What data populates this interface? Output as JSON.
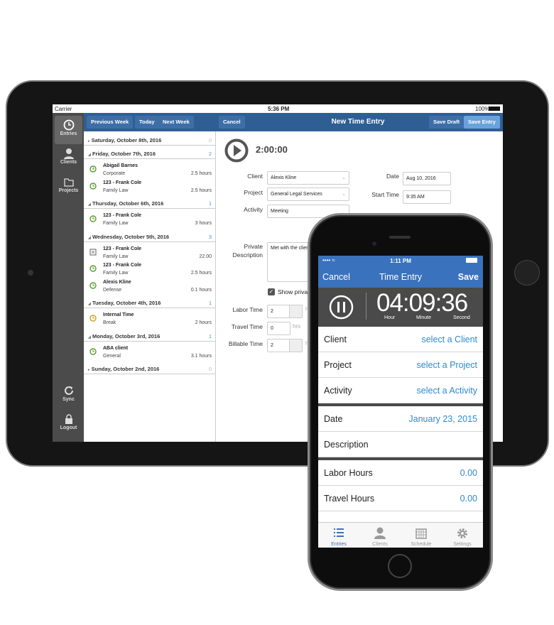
{
  "tablet": {
    "status": {
      "carrier": "Carrier",
      "time": "5:36 PM",
      "battery": "100%"
    },
    "sidebar": {
      "items": [
        {
          "label": "Entries",
          "icon": "clock-icon"
        },
        {
          "label": "Clients",
          "icon": "person-icon"
        },
        {
          "label": "Projects",
          "icon": "folder-icon"
        }
      ],
      "bottom": [
        {
          "label": "Sync",
          "icon": "sync-icon"
        },
        {
          "label": "Logout",
          "icon": "lock-icon"
        }
      ]
    },
    "nav": {
      "prev": "Previous Week",
      "today": "Today",
      "next": "Next Week"
    },
    "header": {
      "cancel": "Cancel",
      "title": "New Time Entry",
      "save_draft": "Save Draft",
      "save_entry": "Save Entry"
    },
    "days": [
      {
        "label": "Saturday, October 8th, 2016",
        "count": "0",
        "entries": []
      },
      {
        "label": "Friday, October 7th, 2016",
        "count": "2",
        "entries": [
          {
            "name": "Abigail Barnes",
            "sub": "Corporate",
            "hours": "2.5 hours",
            "icon": "clock"
          },
          {
            "name": "123 - Frank Cole",
            "sub": "Family Law",
            "hours": "2.5 hours",
            "icon": "clock"
          }
        ]
      },
      {
        "label": "Thursday, October 6th, 2016",
        "count": "1",
        "entries": [
          {
            "name": "123 - Frank Cole",
            "sub": "Family Law",
            "hours": "3 hours",
            "icon": "clock"
          }
        ]
      },
      {
        "label": "Wednesday, October 5th, 2016",
        "count": "3",
        "entries": [
          {
            "name": "123 - Frank Cole",
            "sub": "Family Law",
            "hours": "22.00",
            "icon": "expense"
          },
          {
            "name": "123 - Frank Cole",
            "sub": "Family Law",
            "hours": "2.5 hours",
            "icon": "clock"
          },
          {
            "name": "Alexis Kline",
            "sub": "Defense",
            "hours": "0.1 hours",
            "icon": "clock"
          }
        ]
      },
      {
        "label": "Tuesday, October 4th, 2016",
        "count": "1",
        "entries": [
          {
            "name": "Internal Time",
            "sub": "Break",
            "hours": "2 hours",
            "icon": "clock-yellow"
          }
        ]
      },
      {
        "label": "Monday, October 3rd, 2016",
        "count": "1",
        "entries": [
          {
            "name": "ABA client",
            "sub": "General",
            "hours": "3.1 hours",
            "icon": "clock"
          }
        ]
      },
      {
        "label": "Sunday, October 2nd, 2016",
        "count": "0",
        "entries": []
      }
    ],
    "form": {
      "timer": "2:00:00",
      "client_label": "Client",
      "client": "Alexis Kline",
      "project_label": "Project",
      "project": "General Legal Services",
      "activity_label": "Activity",
      "activity": "Meeting",
      "date_label": "Date",
      "date": "Aug 10, 2016",
      "start_label": "Start Time",
      "start": "9:35 AM",
      "desc_label_1": "Private",
      "desc_label_2": "Description",
      "desc": "Met with the client",
      "show_private": "Show priva",
      "labor_label": "Labor Time",
      "labor": "2",
      "labor_unit": "h",
      "travel_label": "Travel Time",
      "travel": "0",
      "travel_unit": "hrs",
      "billable_label": "Billable Time",
      "billable": "2",
      "billable_unit": "h"
    },
    "colors": {
      "header": "#2f5e95",
      "sidebar": "#4b4b4b",
      "accent": "#4a90d9",
      "clock": "#5a9a2e"
    }
  },
  "phone": {
    "status": {
      "time": "1:11 PM"
    },
    "nav": {
      "cancel": "Cancel",
      "title": "Time Entry",
      "save": "Save"
    },
    "timer": {
      "value": "04:09:36",
      "hour": "Hour",
      "minute": "Minute",
      "second": "Second",
      "state": "running"
    },
    "rows": [
      {
        "label": "Client",
        "value": "select a Client"
      },
      {
        "label": "Project",
        "value": "select a Project"
      },
      {
        "label": "Activity",
        "value": "select a Activity"
      },
      {
        "label": "Date",
        "value": "January 23, 2015"
      },
      {
        "label": "Description",
        "value": ""
      },
      {
        "label": "Labor Hours",
        "value": "0.00"
      },
      {
        "label": "Travel Hours",
        "value": "0.00"
      }
    ],
    "tabs": [
      {
        "label": "Entries",
        "icon": "list-icon",
        "active": true
      },
      {
        "label": "Clients",
        "icon": "person-icon"
      },
      {
        "label": "Schedule",
        "icon": "calendar-icon"
      },
      {
        "label": "Settings",
        "icon": "gear-icon"
      }
    ],
    "colors": {
      "nav": "#3a72bd",
      "value": "#2f8ad0",
      "timer_bg": "#4a4a4a"
    }
  }
}
